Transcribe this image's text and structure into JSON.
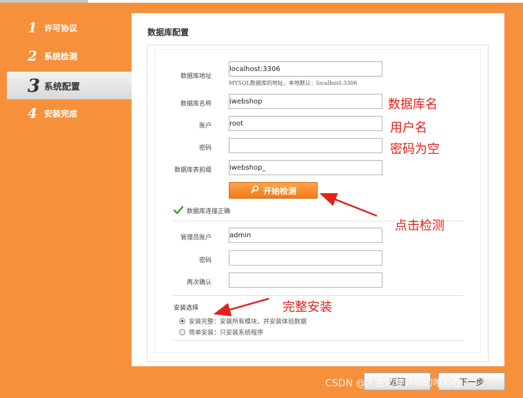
{
  "sidebar": {
    "steps": [
      {
        "number": "1",
        "label": "许可协议"
      },
      {
        "number": "2",
        "label": "系统检测"
      },
      {
        "number": "3",
        "label": "系统配置"
      },
      {
        "number": "4",
        "label": "安装完成"
      }
    ],
    "active_index": 2
  },
  "panel": {
    "title": "数据库配置"
  },
  "db_form": {
    "host_label": "数据库地址",
    "host_value": "localhost:3306",
    "host_hint": "MYSQL数据库的地址，本地默认：localhost:3306",
    "name_label": "数据库名称",
    "name_value": "iwebshop",
    "user_label": "账户",
    "user_value": "root",
    "password_label": "密码",
    "password_value": "",
    "prefix_label": "数据库表前缀",
    "prefix_value": "iwebshop_",
    "check_button": "开始检测",
    "status_text": "数据库连接正确"
  },
  "admin_form": {
    "account_label": "管理员账户",
    "account_value": "admin",
    "password_label": "密码",
    "password_value": "",
    "confirm_label": "再次确认",
    "confirm_value": ""
  },
  "install": {
    "label": "安装选择",
    "options": [
      {
        "text": "安装完整：安装所有模块，并安装体验数据",
        "checked": true
      },
      {
        "text": "简单安装：只安装系统程序",
        "checked": false
      }
    ]
  },
  "footer": {
    "back_button": "返回",
    "next_button": "下一步"
  },
  "annotations": {
    "db_name": "数据库名",
    "user_name": "用户名",
    "password_empty": "密码为空",
    "click_check": "点击检测",
    "full_install": "完整安装"
  },
  "watermark": "CSDN @人生如梦亦如幻唯心在",
  "colors": {
    "background": "#f7903b",
    "accent_button": "#f17b17",
    "annotation": "#e6201a"
  }
}
